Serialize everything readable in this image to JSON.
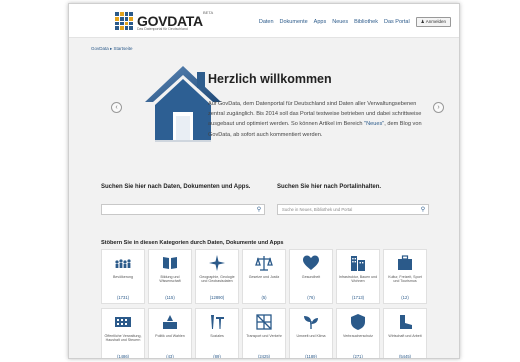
{
  "header": {
    "logo_text": "GOVDATA",
    "logo_beta": "BETA",
    "logo_sub": "Das Datenportal für Deutschland",
    "nav": [
      "Daten",
      "Dokumente",
      "Apps",
      "Neues",
      "Bibliothek",
      "Das Portal"
    ],
    "login_label": "Anmelden"
  },
  "breadcrumb": "GovData ▸ Startseite",
  "hero": {
    "title": "Herzlich willkommen",
    "text_before": "Auf GovData, dem Datenportal für Deutschland sind Daten aller Verwaltungsebenen zentral zugänglich. Bis 2014 soll das Portal testweise betrieben und dabei schrittweise ausgebaut und optimiert werden. So können Artikel im Bereich ",
    "link": "\"Neues\"",
    "text_after": ", dem Blog von GovData, ab sofort auch kommentiert werden.",
    "prev_arrow": "‹",
    "next_arrow": "›"
  },
  "search": {
    "label_data": "Suchen Sie hier nach Daten, Dokumenten und Apps.",
    "label_portal": "Suchen Sie hier nach Portalinhalten.",
    "placeholder_data": "",
    "placeholder_portal": "Suche in Neues, Bibliothek und Portal",
    "search_glyph": "⚲"
  },
  "categories": {
    "title": "Stöbern Sie in diesen Kategorien durch Daten, Dokumente und Apps",
    "items": [
      {
        "label": "Bevölkerung",
        "count": "(1731)",
        "icon": "population-icon"
      },
      {
        "label": "Bildung und Wissenschaft",
        "count": "(115)",
        "icon": "book-icon"
      },
      {
        "label": "Geographie, Geologie und Geobasisdaten",
        "count": "(12890)",
        "icon": "compass-icon"
      },
      {
        "label": "Gesetze und Justiz",
        "count": "(5)",
        "icon": "scales-icon"
      },
      {
        "label": "Gesundheit",
        "count": "(76)",
        "icon": "heart-icon"
      },
      {
        "label": "Infrastruktur, Bauen und Wohnen",
        "count": "(1713)",
        "icon": "buildings-icon"
      },
      {
        "label": "Kultur, Freizeit, Sport und Tourismus",
        "count": "(12)",
        "icon": "suitcase-icon"
      },
      {
        "label": "Öffentliche Verwaltung, Haushalt und Steuern",
        "count": "(1486)",
        "icon": "government-icon"
      },
      {
        "label": "Politik und Wahlen",
        "count": "(43)",
        "icon": "ballot-icon"
      },
      {
        "label": "Soziales",
        "count": "(89)",
        "icon": "people-icon"
      },
      {
        "label": "Transport und Verkehr",
        "count": "(2425)",
        "icon": "transport-icon"
      },
      {
        "label": "Umwelt und Klima",
        "count": "(1189)",
        "icon": "plant-icon"
      },
      {
        "label": "Verbraucherschutz",
        "count": "(271)",
        "icon": "shield-icon"
      },
      {
        "label": "Wirtschaft und Arbeit",
        "count": "(5445)",
        "icon": "boot-icon"
      }
    ]
  },
  "colors": {
    "brand_blue": "#2b5a8a",
    "logo_yellow": "#e3a31c",
    "page_bg": "#f2f2f2"
  }
}
